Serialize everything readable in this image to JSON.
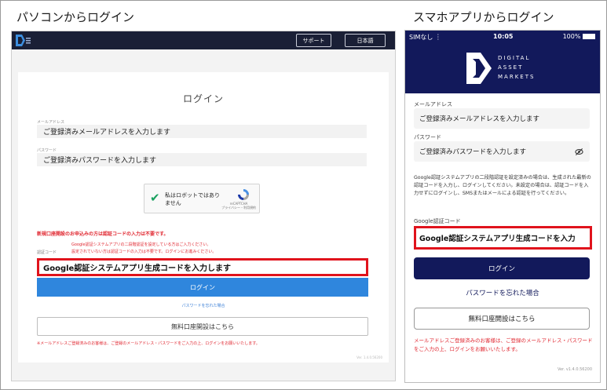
{
  "sections": {
    "pc_title": "パソコンからログイン",
    "sp_title": "スマホアプリからログイン"
  },
  "colors": {
    "navy": "#12195b",
    "pc_header": "#1a1f36",
    "pc_login_blue": "#2f86dd",
    "highlight_red": "#e0131c",
    "warning_red": "#e0262f"
  },
  "pc": {
    "header": {
      "support_label": "サポート",
      "language_label": "日本語",
      "logo_icon": "dam-logo-icon"
    },
    "title": "ログイン",
    "email_label": "メールアドレス",
    "email_placeholder": "ご登録済みメールアドレスを入力します",
    "password_label": "パスワード",
    "password_placeholder": "ご登録済みパスワードを入力します",
    "recaptcha": {
      "label": "私はロボットではありません",
      "brand": "reCAPTCHA",
      "links": "プライバシー・利用規約"
    },
    "notice_new_account": "新規口座開設のお申込みの方は認証コードの入力は不要です。",
    "notice_2fa_set": "Google認証システムアプリの二段階認証を設定している方はご入力ください。",
    "notice_2fa_unset": "設定されていない方は認証コードの入力は不要です。ログインにお進みください。",
    "code_label": "認証コード",
    "code_placeholder": "Google認証システムアプリ生成コードを入力します",
    "login_button": "ログイン",
    "forgot_link": "パスワードを忘れた場合",
    "open_account_button": "無料口座開設はこちら",
    "footer_note": "※メールアドレスご登録済みのお客様は、ご登録のメールアドレス・パスワードをご入力の上、ログインをお願いいたします。",
    "version": "Ver. 1.4.0.56200"
  },
  "sp": {
    "status": {
      "carrier": "SIMなし",
      "time": "10:05",
      "battery": "100%"
    },
    "brand_lines": [
      "DIGITAL",
      "ASSET",
      "MARKETS"
    ],
    "email_label": "メールアドレス",
    "email_placeholder": "ご登録済みメールアドレスを入力します",
    "password_label": "パスワード",
    "password_placeholder": "ご登録済みパスワードを入力します",
    "info_text": "Google認証システムアプリの二段階認証を設定済みの場合は、生成された最新の認証コードを入力し、ログインしてください。未設定の場合は、認証コードを入力せずにログインし、SMSまたはメールによる認証を行ってください。",
    "code_label": "Google認証コード",
    "code_placeholder": "Google認証システムアプリ生成コードを入力",
    "login_button": "ログイン",
    "forgot_link": "パスワードを忘れた場合",
    "open_account_button": "無料口座開設はこちら",
    "footer_note": "メールアドレスご登録済みのお客様は、ご登録のメールアドレス・パスワードをご入力の上、ログインをお願いいたします。",
    "version": "Ver. v1.4.0.56200"
  }
}
